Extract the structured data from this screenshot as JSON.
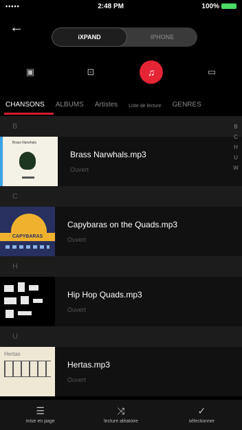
{
  "status": {
    "signal": "•••••",
    "time": "2:48 PM",
    "battery": "100%"
  },
  "header": {
    "back_icon": "←",
    "segments": [
      {
        "label": "iXPAND"
      },
      {
        "label": "iPHONE"
      }
    ]
  },
  "icon_bar": [
    {
      "name": "photo-icon",
      "glyph": "▣"
    },
    {
      "name": "video-icon",
      "glyph": "⊡"
    },
    {
      "name": "music-icon",
      "glyph": "♫"
    },
    {
      "name": "folder-icon",
      "glyph": "▭"
    }
  ],
  "tabs": [
    {
      "label": "CHANSONS"
    },
    {
      "label": "ALBUMS"
    },
    {
      "label": "Artistes"
    },
    {
      "label": "Liste de lecture"
    },
    {
      "label": "GENRES"
    }
  ],
  "sections": [
    {
      "letter": "B",
      "items": [
        {
          "title": "Brass Narwhals.mp3",
          "subtitle": "Ouvert",
          "art_caption": "Brass Narwhals"
        }
      ]
    },
    {
      "letter": "C",
      "items": [
        {
          "title": "Capybaras on the Quads.mp3",
          "subtitle": "Ouvert",
          "art_caption": "CAPYBARAS"
        }
      ]
    },
    {
      "letter": "H",
      "items": [
        {
          "title": "Hip Hop Quads.mp3",
          "subtitle": "Ouvert"
        }
      ]
    },
    {
      "letter": "U",
      "items": [
        {
          "title": "Hertas.mp3",
          "subtitle": "Ouvert",
          "art_caption": "Hertas"
        }
      ]
    }
  ],
  "alpha_index": [
    "B",
    "C",
    "H",
    "U",
    "W"
  ],
  "bottom_bar": [
    {
      "icon": "☰",
      "label": "mise en page"
    },
    {
      "icon": "⤨",
      "label": "lecture aléatoire"
    },
    {
      "icon": "✓",
      "label": "sélectionner"
    }
  ]
}
